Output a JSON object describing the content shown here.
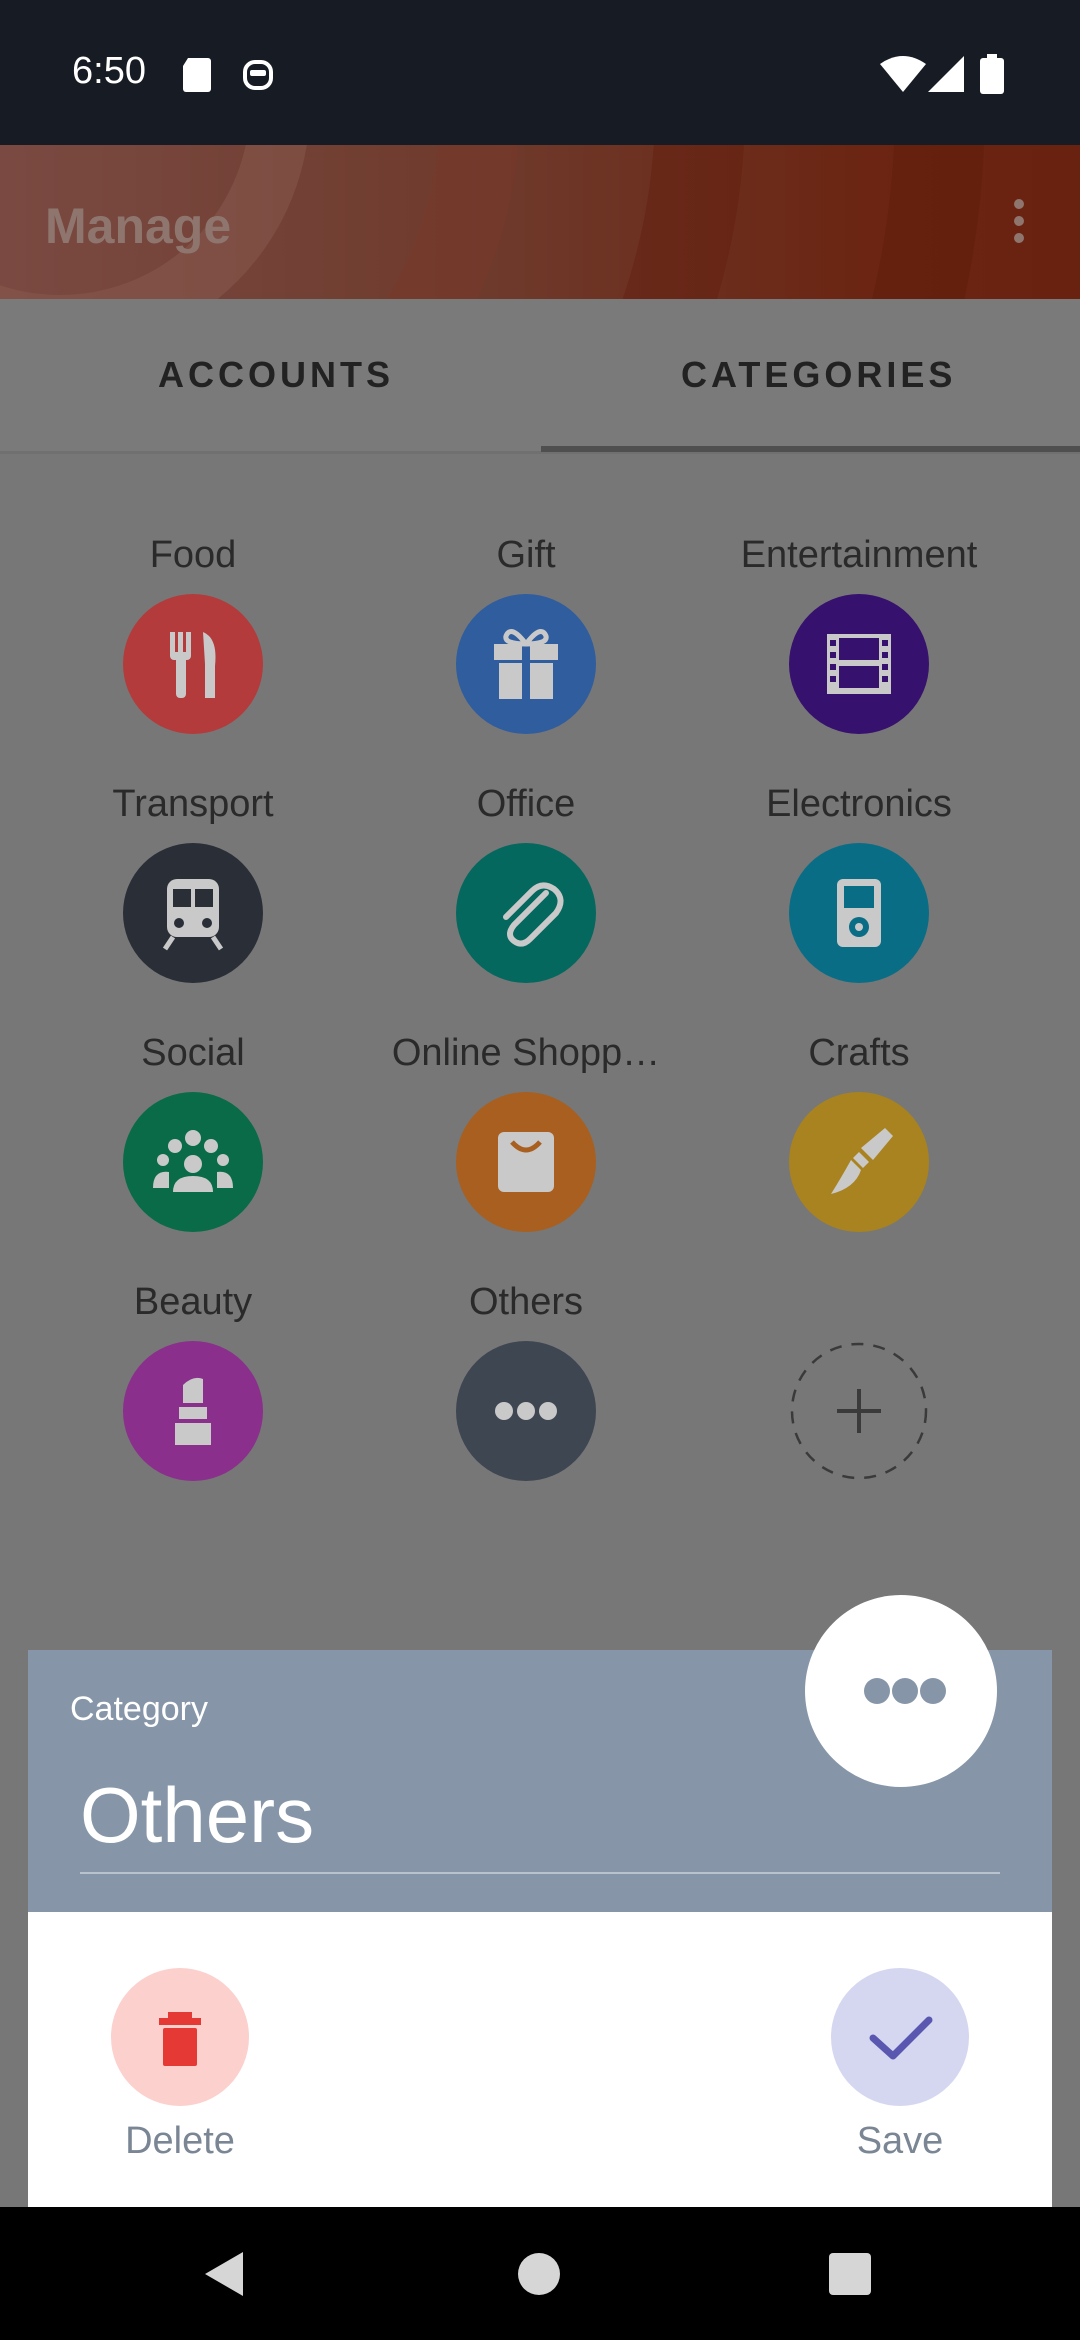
{
  "status_bar": {
    "time": "6:50"
  },
  "header": {
    "title": "Manage"
  },
  "tabs": [
    {
      "label": "ACCOUNTS"
    },
    {
      "label": "CATEGORIES"
    }
  ],
  "categories": [
    {
      "label": "Food",
      "color": "#b33b3b",
      "icon": "cutlery-icon"
    },
    {
      "label": "Gift",
      "color": "#2f5d9e",
      "icon": "gift-icon"
    },
    {
      "label": "Entertainment",
      "color": "#36116e",
      "icon": "film-icon"
    },
    {
      "label": "Transport",
      "color": "#2a2e36",
      "icon": "train-icon"
    },
    {
      "label": "Office",
      "color": "#05685e",
      "icon": "paperclip-icon"
    },
    {
      "label": "Electronics",
      "color": "#0a6d86",
      "icon": "music-player-icon"
    },
    {
      "label": "Social",
      "color": "#0a6b48",
      "icon": "group-icon"
    },
    {
      "label": "Online Shopp…",
      "color": "#a85f1f",
      "icon": "shopping-bag-icon"
    },
    {
      "label": "Crafts",
      "color": "#a8831f",
      "icon": "paint-brush-icon"
    },
    {
      "label": "Beauty",
      "color": "#8a2f8c",
      "icon": "lipstick-icon"
    },
    {
      "label": "Others",
      "color": "#3e4652",
      "icon": "more-dots-icon"
    }
  ],
  "add_category": {
    "icon": "plus-icon"
  },
  "dialog": {
    "caption": "Category",
    "name_value": "Others",
    "icon": "more-dots-icon",
    "delete_label": "Delete",
    "save_label": "Save",
    "delete_color": "#e53935",
    "save_color": "#5a57b0"
  }
}
